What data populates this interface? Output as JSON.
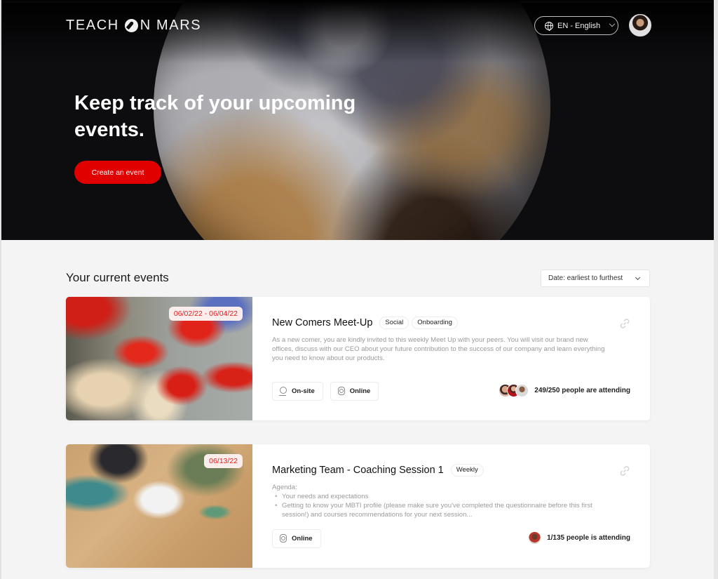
{
  "header": {
    "logo_part1": "TEACH",
    "logo_part2": "N MARS",
    "language": "EN - English",
    "user_avatar": "user-avatar"
  },
  "hero": {
    "title": "Keep track of your upcoming events.",
    "cta_label": "Create an event",
    "accent_color": "#e00000"
  },
  "events_section": {
    "title": "Your current events",
    "sort_value": "Date: earliest to furthest"
  },
  "events": [
    {
      "date": "06/02/22 - 06/04/22",
      "title": "New Comers Meet-Up",
      "tags": [
        "Social",
        "Onboarding"
      ],
      "description": "As a new comer, you are kindly invited to this weekly Meet Up with your peers. You will visit our brand new offices, discuss with our CEO about your future contribution to the success of our company and learn everything you need to know about our products.",
      "modes": [
        "On-site",
        "Online"
      ],
      "attendance": "249/250 people are attending",
      "image": "origami-cranes"
    },
    {
      "date": "06/13/22",
      "title": "Marketing Team - Coaching Session 1",
      "tags": [
        "Weekly"
      ],
      "agenda_label": "Agenda:",
      "agenda_items": [
        "Your needs and expectations",
        "Getting to know your MBTI profile (please make sure you've completed the questionnaire before this first session!) and courses recommendations for your next session..."
      ],
      "modes": [
        "Online"
      ],
      "attendance": "1/135 people is attending",
      "image": "marketing-desk"
    }
  ]
}
